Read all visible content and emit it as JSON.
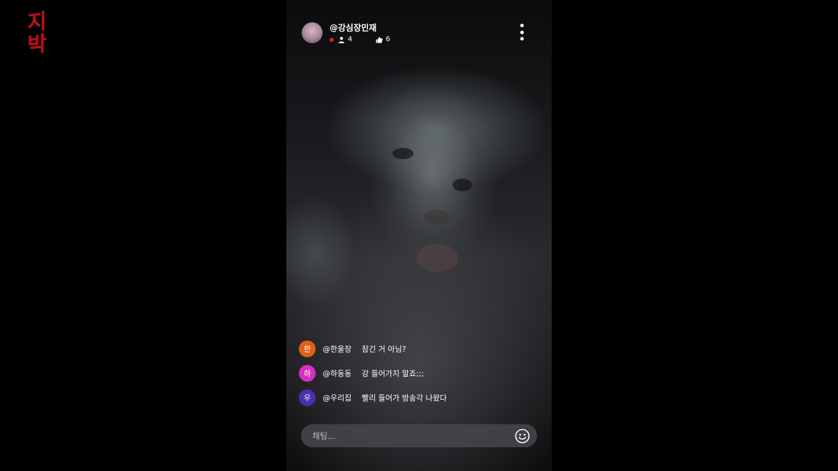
{
  "logo": {
    "text": "지박"
  },
  "stream": {
    "username": "@강심장민재",
    "viewers": "4",
    "likes": "6"
  },
  "chat": {
    "messages": [
      {
        "avatar_letter": "한",
        "avatar_color": "#e0601a",
        "user": "@한울장",
        "text": "잠긴 거 아님?"
      },
      {
        "avatar_letter": "하",
        "avatar_color": "#d92fbf",
        "user": "@하동동",
        "text": "강 들어가지 말죠;;;"
      },
      {
        "avatar_letter": "우",
        "avatar_color": "#4b2fb0",
        "user": "@우리집",
        "text": "빨리 들어가 방송각 나왔다"
      }
    ],
    "input_placeholder": "채팅..."
  },
  "colors": {
    "logo": "#b3121b",
    "live_dot": "#e21b1b"
  },
  "icons": {
    "viewers": "person-icon",
    "likes": "thumbs-up-icon",
    "menu": "more-vertical-icon",
    "emoji": "smiley-icon"
  }
}
